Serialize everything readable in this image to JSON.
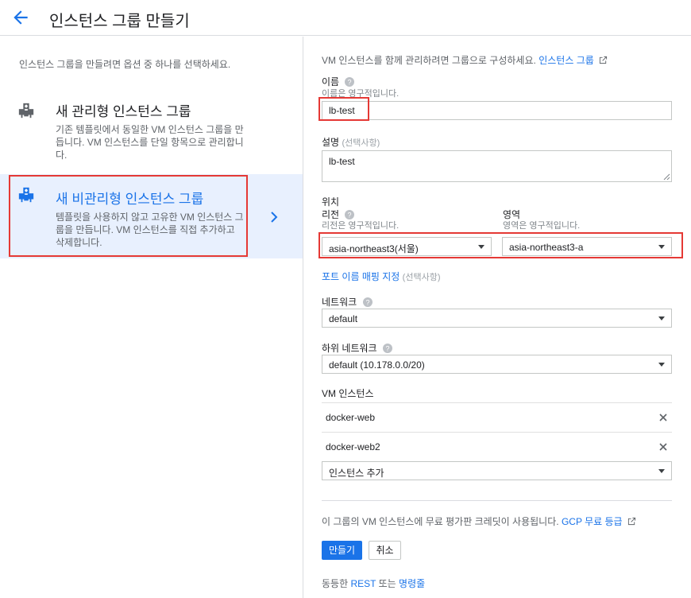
{
  "header": {
    "title": "인스턴스 그룹 만들기",
    "back_icon": "arrow-back-icon"
  },
  "left": {
    "intro": "인스턴스 그룹을 만들려면 옵션 중 하나를 선택하세요.",
    "options": [
      {
        "title": "새 관리형 인스턴스 그룹",
        "desc": "기존 템플릿에서 동일한 VM 인스턴스 그룹을 만듭니다. VM 인스턴스를 단일 항목으로 관리합니다.",
        "icon": "instance-group-icon"
      },
      {
        "title": "새 비관리형 인스턴스 그룹",
        "desc": "템플릿을 사용하지 않고 고유한 VM 인스턴스 그룹을 만듭니다. VM 인스턴스를 직접 추가하고 삭제합니다.",
        "icon": "instance-group-icon",
        "selected": true
      }
    ]
  },
  "form": {
    "intro_text": "VM 인스턴스를 함께 관리하려면 그룹으로 구성하세요.",
    "intro_link": "인스턴스 그룹",
    "name": {
      "label": "이름",
      "hint": "이름은 영구적입니다.",
      "value": "lb-test"
    },
    "description": {
      "label": "설명",
      "optional": "(선택사항)",
      "value": "lb-test"
    },
    "location": {
      "label": "위치",
      "region_label": "리전",
      "region_hint": "리전은 영구적입니다.",
      "region_value": "asia-northeast3(서울)",
      "zone_label": "영역",
      "zone_hint": "영역은 영구적입니다.",
      "zone_value": "asia-northeast3-a"
    },
    "port_mapping": {
      "link": "포트 이름 매핑 지정",
      "optional": "(선택사항)"
    },
    "network": {
      "label": "네트워크",
      "value": "default"
    },
    "subnetwork": {
      "label": "하위 네트워크",
      "value": "default (10.178.0.0/20)"
    },
    "vm_instances": {
      "label": "VM 인스턴스",
      "items": [
        "docker-web",
        "docker-web2"
      ],
      "add_placeholder": "인스턴스 추가"
    },
    "credit_text": "이 그룹의 VM 인스턴스에 무료 평가판 크레딧이 사용됩니다.",
    "credit_link": "GCP 무료 등급",
    "create_label": "만들기",
    "cancel_label": "취소",
    "equiv_prefix": "동등한",
    "equiv_rest": "REST",
    "equiv_or": "또는",
    "equiv_cmd": "명령줄"
  },
  "colors": {
    "accent": "#1a73e8",
    "highlight": "#e53935",
    "selected_bg": "#e8f0fe"
  }
}
